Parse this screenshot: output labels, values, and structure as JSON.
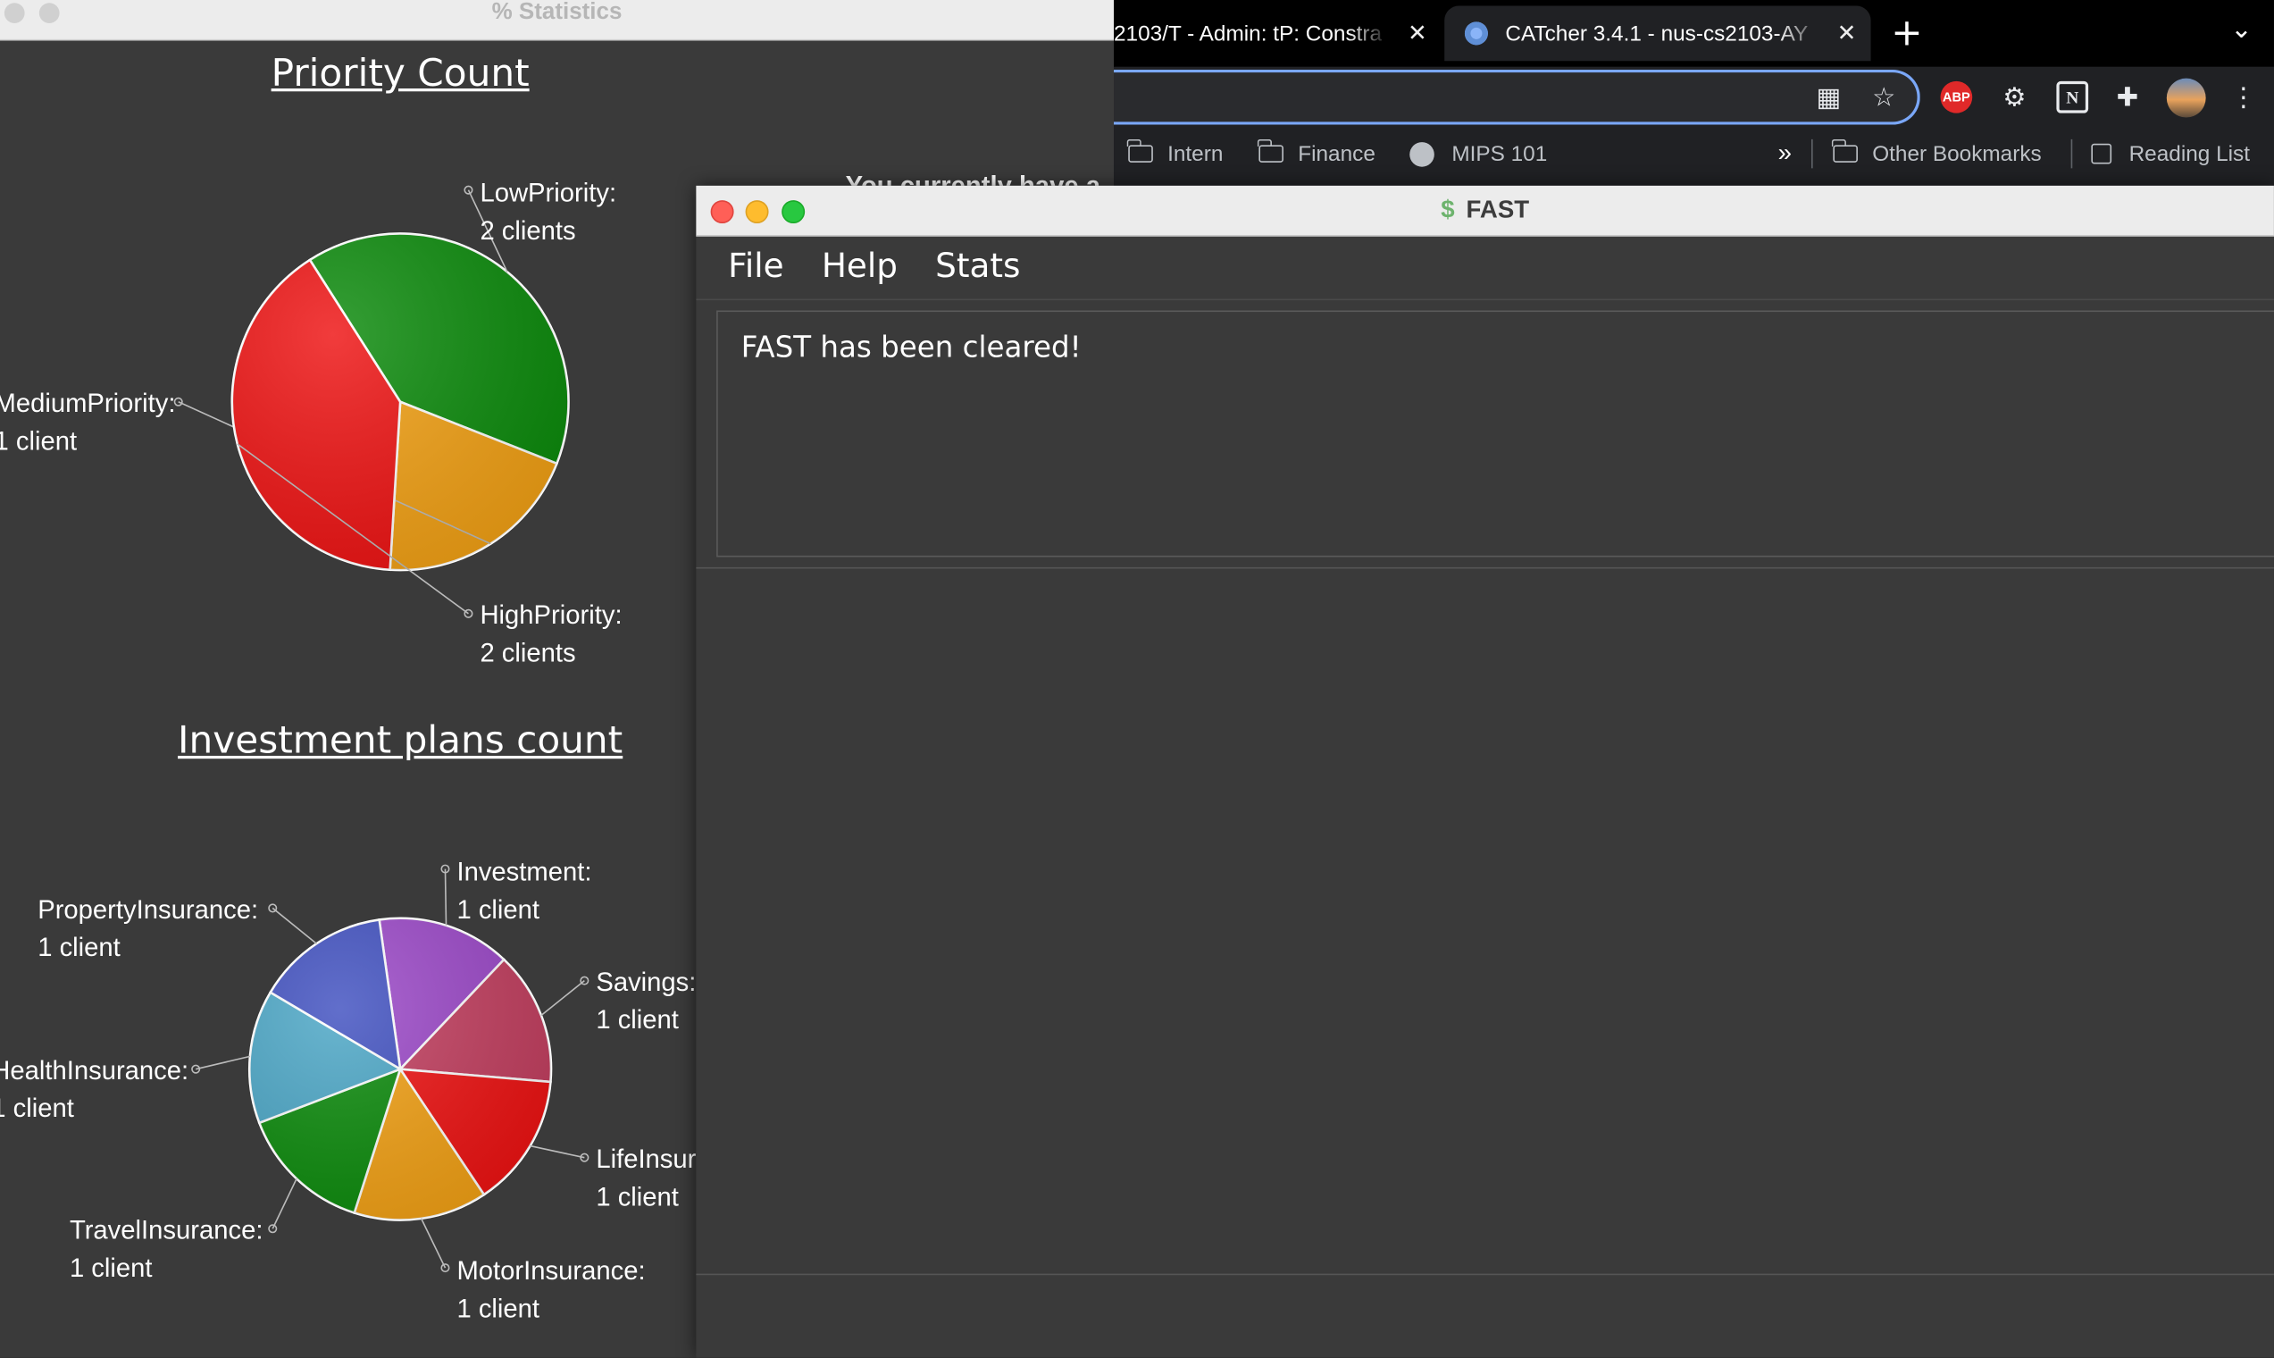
{
  "browser": {
    "tabs": [
      {
        "label": "2103/T - Admin: tP: Constra"
      },
      {
        "label": "CATcher 3.4.1 - nus-cs2103-AY"
      }
    ],
    "new_tab_label": "+",
    "bookmarks": [
      {
        "label": "Intern",
        "icon": "folder-icon"
      },
      {
        "label": "Finance",
        "icon": "folder-icon"
      },
      {
        "label": "MIPS 101",
        "icon": "globe-icon"
      }
    ],
    "bookmarks_overflow": "»",
    "other_bookmarks": "Other Bookmarks",
    "reading_list": "Reading List",
    "extension_abp_label": "ABP"
  },
  "stats_window": {
    "title": "% Statistics",
    "behind_text": "You currently have a",
    "priority_chart_title": "Priority Count",
    "investment_chart_title": "Investment plans count"
  },
  "chart_data": [
    {
      "type": "pie",
      "title": "Priority Count",
      "categories": [
        "LowPriority",
        "MediumPriority",
        "HighPriority"
      ],
      "values": [
        2,
        1,
        2
      ],
      "labels": [
        [
          "LowPriority:",
          "2 clients"
        ],
        [
          "MediumPriority:",
          "1 client"
        ],
        [
          "HighPriority:",
          "2 clients"
        ]
      ],
      "colors": [
        "#0a8a0a",
        "#f2a013",
        "#ee1111"
      ]
    },
    {
      "type": "pie",
      "title": "Investment plans count",
      "categories": [
        "Investment",
        "Savings",
        "LifeInsurance",
        "MotorInsurance",
        "TravelInsurance",
        "HealthInsurance",
        "PropertyInsurance"
      ],
      "values": [
        1,
        1,
        1,
        1,
        1,
        1,
        1
      ],
      "labels": [
        [
          "Investment:",
          "1 client"
        ],
        [
          "Savings:",
          "1 client"
        ],
        [
          "LifeInsur",
          "1 client"
        ],
        [
          "MotorInsurance:",
          "1 client"
        ],
        [
          "TravelInsurance:",
          "1 client"
        ],
        [
          "HealthInsurance:",
          "1 client"
        ],
        [
          "PropertyInsurance:",
          "1 client"
        ]
      ],
      "colors": [
        "#9b47c8",
        "#c23d5e",
        "#ee1111",
        "#f2a013",
        "#0a8a0a",
        "#4aa6c6",
        "#3f4fc0"
      ]
    }
  ],
  "fast_window": {
    "title": "FAST",
    "menu": [
      "File",
      "Help",
      "Stats"
    ],
    "result_text": "FAST has been cleared!"
  }
}
